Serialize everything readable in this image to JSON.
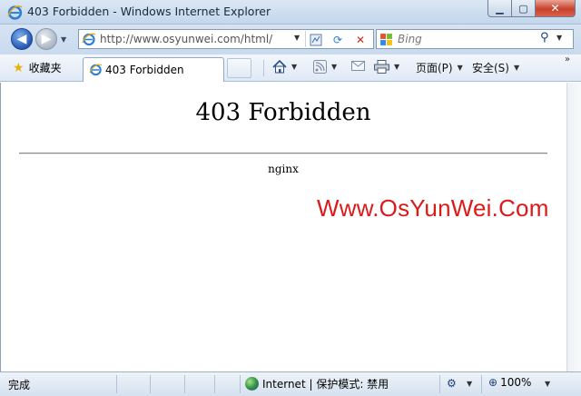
{
  "window": {
    "title": "403 Forbidden - Windows Internet Explorer"
  },
  "navigation": {
    "back_icon": "back-arrow-icon",
    "forward_icon": "forward-arrow-icon",
    "address_url": "http://www.osyunwei.com/html/",
    "search_placeholder": "Bing"
  },
  "toolbar": {
    "favorites_label": "收藏夹",
    "tab_label": "403 Forbidden",
    "page_menu": "页面(P)",
    "safety_menu": "安全(S)"
  },
  "content": {
    "heading": "403 Forbidden",
    "server": "nginx",
    "watermark": "Www.OsYunWei.Com"
  },
  "status": {
    "text": "完成",
    "zone": "Internet | 保护模式: 禁用",
    "zoom": "100%"
  },
  "colors": {
    "watermark": "#dd1a1a",
    "chrome": "#c9daee"
  }
}
